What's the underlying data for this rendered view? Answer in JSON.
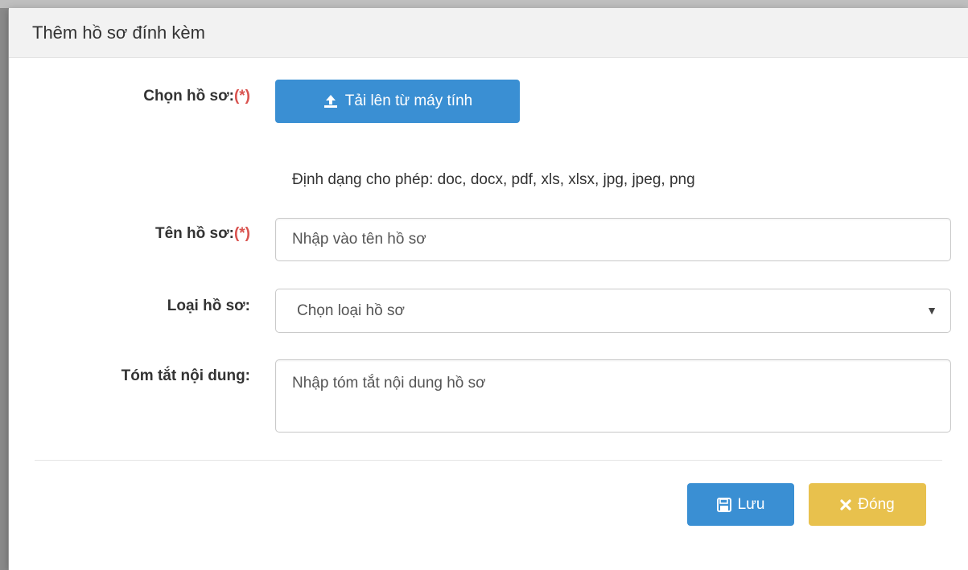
{
  "dialog": {
    "title": "Thêm hồ sơ đính kèm"
  },
  "form": {
    "file": {
      "label": "Chọn hồ sơ:",
      "required_mark": "(*)",
      "upload_button": "Tải lên từ máy tính",
      "allowed_formats": "Định dạng cho phép: doc, docx, pdf, xls, xlsx, jpg, jpeg, png"
    },
    "name": {
      "label": "Tên hồ sơ:",
      "required_mark": "(*)",
      "value": "",
      "placeholder": "Nhập vào tên hồ sơ"
    },
    "type": {
      "label": "Loại hồ sơ:",
      "selected": "Chọn loại hồ sơ"
    },
    "summary": {
      "label": "Tóm tắt nội dung:",
      "value": "",
      "placeholder": "Nhập tóm tắt nội dung hồ sơ"
    }
  },
  "footer": {
    "save_label": "Lưu",
    "close_label": "Đóng"
  },
  "colors": {
    "primary": "#3a8fd3",
    "warning": "#e8c14d",
    "required": "#d9534f"
  },
  "icons": {
    "upload": "upload-icon",
    "save": "floppy-disk-icon",
    "close": "close-icon",
    "dropdown": "caret-down-icon"
  }
}
